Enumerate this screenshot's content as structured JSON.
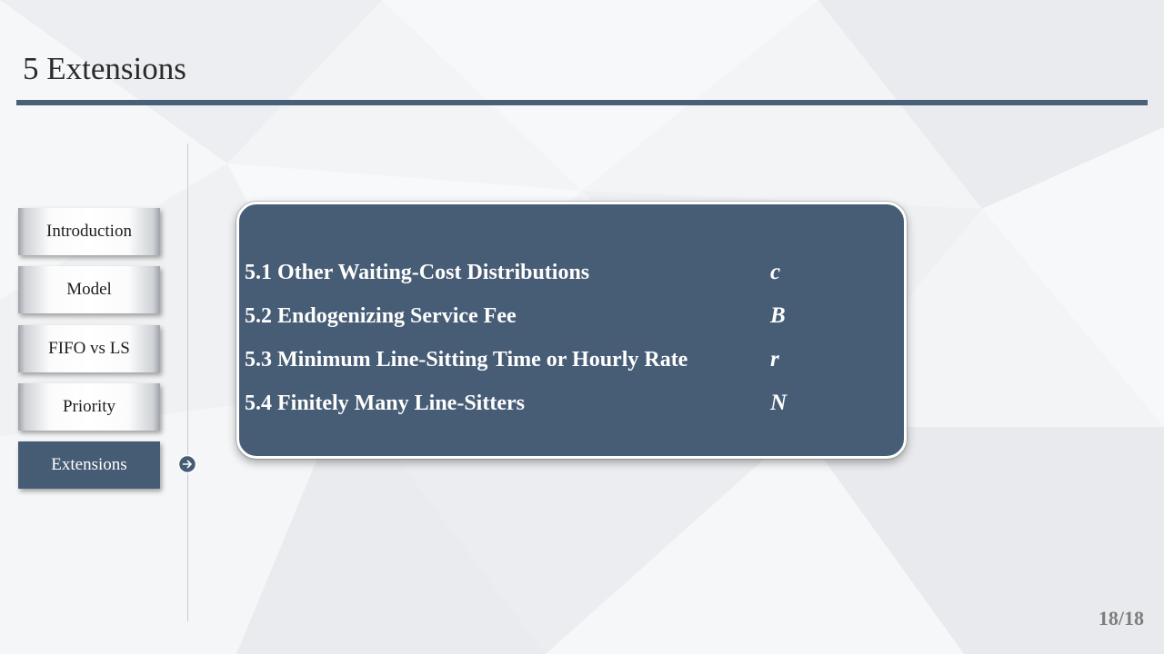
{
  "slide": {
    "title": "5 Extensions",
    "page_number": "18/18"
  },
  "nav": {
    "items": [
      {
        "label": "Introduction",
        "active": false
      },
      {
        "label": "Model",
        "active": false
      },
      {
        "label": "FIFO vs LS",
        "active": false
      },
      {
        "label": "Priority",
        "active": false
      },
      {
        "label": "Extensions",
        "active": true
      }
    ],
    "current_indicator_icon": "circled-arrow-right-icon"
  },
  "panel": {
    "rows": [
      {
        "label": "5.1 Other Waiting-Cost Distributions",
        "variable": "c"
      },
      {
        "label": "5.2 Endogenizing Service Fee",
        "variable": "B"
      },
      {
        "label": "5.3 Minimum Line-Sitting Time or Hourly Rate",
        "variable": "r"
      },
      {
        "label": "5.4 Finitely Many Line-Sitters",
        "variable": "N"
      }
    ]
  },
  "colors": {
    "accent": "#465b74",
    "title_rule": "#4a5f78",
    "panel_text": "#ffffff",
    "page_number": "#7d7d7d"
  }
}
